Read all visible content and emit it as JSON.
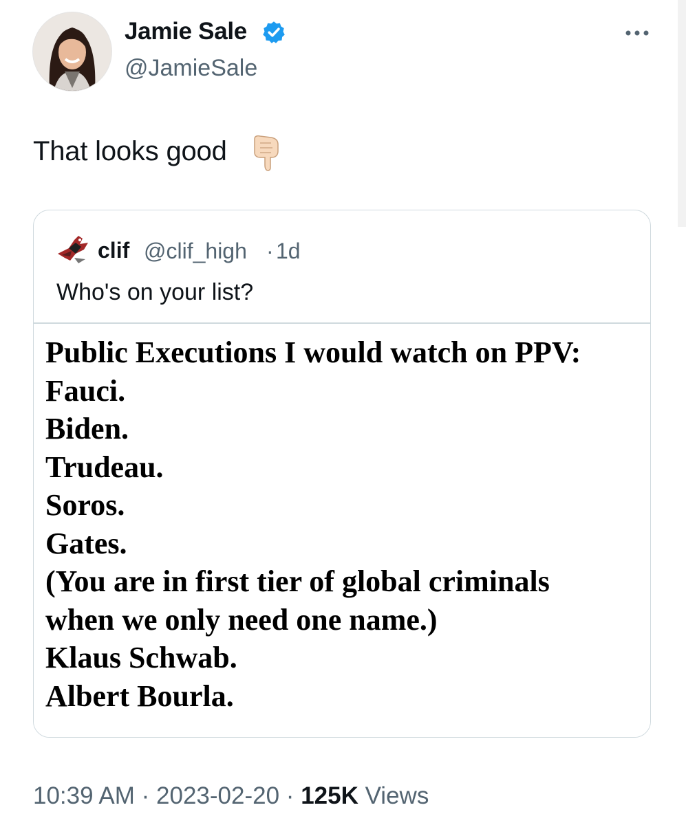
{
  "author": {
    "display_name": "Jamie Sale",
    "handle": "@JamieSale",
    "verified_color": "#1d9bf0"
  },
  "tweet": {
    "text": "That looks good",
    "emoji": "backhand-index-pointing-down-icon"
  },
  "quoted_tweet": {
    "display_name": "clif",
    "handle": "@clif_high",
    "separator": "·",
    "age": "1d",
    "text": "Who's on your list?",
    "image_text_lines": [
      "Public Executions I would watch on PPV:",
      "Fauci.",
      "Biden.",
      "Trudeau.",
      "Soros.",
      "Gates.",
      "(You are in first tier of global criminals",
      "when we only need one name.)",
      "Klaus Schwab.",
      "Albert Bourla."
    ]
  },
  "meta": {
    "time": "10:39 AM",
    "separator": "·",
    "date": "2023-02-20",
    "views_count": "125K",
    "views_label": "Views"
  },
  "colors": {
    "text_primary": "#0f1419",
    "text_secondary": "#536471",
    "border": "#cfd9de"
  }
}
